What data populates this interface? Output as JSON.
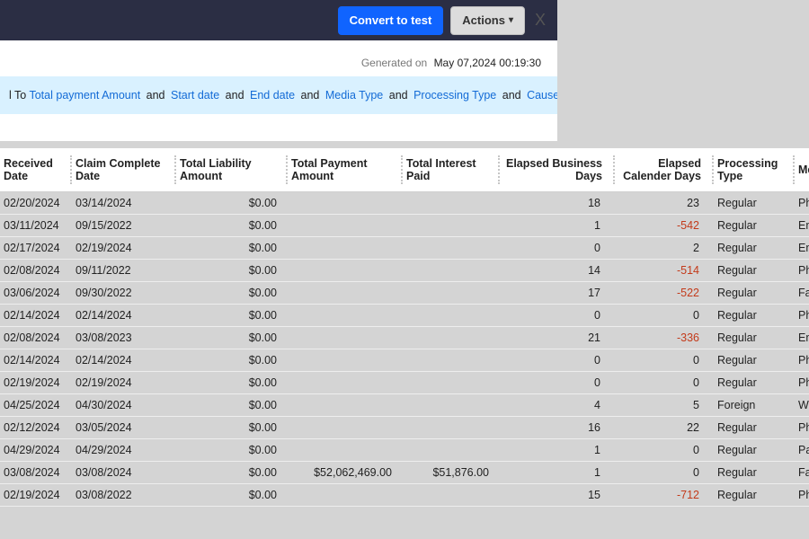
{
  "topbar": {
    "convert_label": "Convert to test",
    "actions_label": "Actions",
    "close_label": "X"
  },
  "meta": {
    "generated_label": "Generated on",
    "generated_value": "May 07,2024 00:19:30"
  },
  "filters": {
    "lead_fragment": "l To",
    "items": [
      "Total payment Amount",
      "Start date",
      "End date",
      "Media Type",
      "Processing Type",
      "Cause of Death"
    ],
    "joiner": "and"
  },
  "columns": [
    "Received Date",
    "Claim Complete Date",
    "Total Liability Amount",
    "Total Payment Amount",
    "Total Interest Paid",
    "Elapsed Business Days",
    "Elapsed Calender Days",
    "Processing Type",
    "Media Type"
  ],
  "rows": [
    {
      "received": "02/20/2024",
      "complete": "03/14/2024",
      "liab": "$0.00",
      "pay": "",
      "interest": "",
      "ebd": "18",
      "ecd": "23",
      "ptype": "Regular",
      "media": "Phone Call"
    },
    {
      "received": "03/11/2024",
      "complete": "09/15/2022",
      "liab": "$0.00",
      "pay": "",
      "interest": "",
      "ebd": "1",
      "ecd": "-542",
      "ptype": "Regular",
      "media": "Email"
    },
    {
      "received": "02/17/2024",
      "complete": "02/19/2024",
      "liab": "$0.00",
      "pay": "",
      "interest": "",
      "ebd": "0",
      "ecd": "2",
      "ptype": "Regular",
      "media": "Email"
    },
    {
      "received": "02/08/2024",
      "complete": "09/11/2022",
      "liab": "$0.00",
      "pay": "",
      "interest": "",
      "ebd": "14",
      "ecd": "-514",
      "ptype": "Regular",
      "media": "Phone Call"
    },
    {
      "received": "03/06/2024",
      "complete": "09/30/2022",
      "liab": "$0.00",
      "pay": "",
      "interest": "",
      "ebd": "17",
      "ecd": "-522",
      "ptype": "Regular",
      "media": "Fax"
    },
    {
      "received": "02/14/2024",
      "complete": "02/14/2024",
      "liab": "$0.00",
      "pay": "",
      "interest": "",
      "ebd": "0",
      "ecd": "0",
      "ptype": "Regular",
      "media": "Phone Call"
    },
    {
      "received": "02/08/2024",
      "complete": "03/08/2023",
      "liab": "$0.00",
      "pay": "",
      "interest": "",
      "ebd": "21",
      "ecd": "-336",
      "ptype": "Regular",
      "media": "Email"
    },
    {
      "received": "02/14/2024",
      "complete": "02/14/2024",
      "liab": "$0.00",
      "pay": "",
      "interest": "",
      "ebd": "0",
      "ecd": "0",
      "ptype": "Regular",
      "media": "Phone Call"
    },
    {
      "received": "02/19/2024",
      "complete": "02/19/2024",
      "liab": "$0.00",
      "pay": "",
      "interest": "",
      "ebd": "0",
      "ecd": "0",
      "ptype": "Regular",
      "media": "Phone Call"
    },
    {
      "received": "04/25/2024",
      "complete": "04/30/2024",
      "liab": "$0.00",
      "pay": "",
      "interest": "",
      "ebd": "4",
      "ecd": "5",
      "ptype": "Foreign",
      "media": "Web"
    },
    {
      "received": "02/12/2024",
      "complete": "03/05/2024",
      "liab": "$0.00",
      "pay": "",
      "interest": "",
      "ebd": "16",
      "ecd": "22",
      "ptype": "Regular",
      "media": "Phone Call"
    },
    {
      "received": "04/29/2024",
      "complete": "04/29/2024",
      "liab": "$0.00",
      "pay": "",
      "interest": "",
      "ebd": "1",
      "ecd": "0",
      "ptype": "Regular",
      "media": "Paper"
    },
    {
      "received": "03/08/2024",
      "complete": "03/08/2024",
      "liab": "$0.00",
      "pay": "$52,062,469.00",
      "interest": "$51,876.00",
      "ebd": "1",
      "ecd": "0",
      "ptype": "Regular",
      "media": "Fax"
    },
    {
      "received": "02/19/2024",
      "complete": "03/08/2022",
      "liab": "$0.00",
      "pay": "",
      "interest": "",
      "ebd": "15",
      "ecd": "-712",
      "ptype": "Regular",
      "media": "Phone Call"
    }
  ]
}
